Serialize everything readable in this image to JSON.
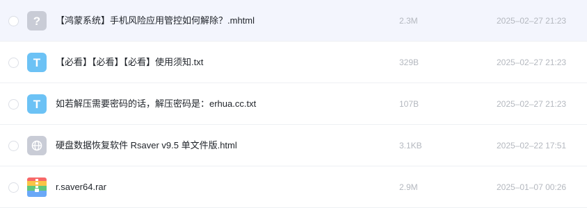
{
  "files": [
    {
      "name": "【鸿蒙系统】手机风险应用管控如何解除？.mhtml",
      "size": "2.3M",
      "date": "2025–02–27 21:23",
      "icon": "unknown-file-icon",
      "glyph": "?",
      "selected": true
    },
    {
      "name": "【必看】【必看】【必看】使用须知.txt",
      "size": "329B",
      "date": "2025–02–27 21:23",
      "icon": "text-file-icon",
      "glyph": "T",
      "selected": false
    },
    {
      "name": "如若解压需要密码的话，解压密码是：erhua.cc.txt",
      "size": "107B",
      "date": "2025–02–27 21:23",
      "icon": "text-file-icon",
      "glyph": "T",
      "selected": false
    },
    {
      "name": "硬盘数据恢复软件 Rsaver v9.5 单文件版.html",
      "size": "3.1KB",
      "date": "2025–02–22 17:51",
      "icon": "web-file-icon",
      "glyph": "",
      "selected": false
    },
    {
      "name": "r.saver64.rar",
      "size": "2.9M",
      "date": "2025–01–07 00:26",
      "icon": "archive-file-icon",
      "glyph": "",
      "selected": false
    }
  ],
  "colors": {
    "selected_row_bg": "#f3f5fd",
    "unknown_icon_bg": "#c9ccd6",
    "text_icon_bg": "#6cc2f5",
    "web_icon_bg": "#c9ccd6",
    "archive_colors": [
      "#f76868",
      "#f9c446",
      "#5fc77b",
      "#6aa8f7"
    ]
  }
}
